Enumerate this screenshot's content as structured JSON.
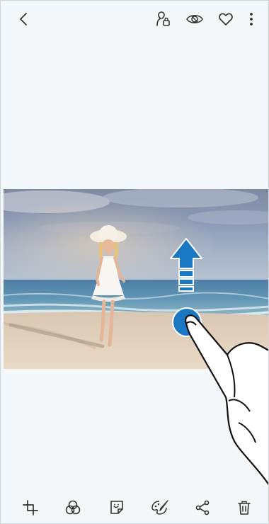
{
  "top_bar": {
    "back_icon": "chevron-left-icon",
    "portrait_icon": "portrait-effect-icon",
    "view_icon": "view-icon",
    "favorite_icon": "heart-icon",
    "more_icon": "more-vertical-icon"
  },
  "photo": {
    "subject": "girl-on-beach-photo"
  },
  "gesture": {
    "direction": "swipe-up",
    "arrow_color": "#1a77c2",
    "touch_color": "#1a77c2"
  },
  "bottom_bar": {
    "items": [
      {
        "icon": "crop-icon"
      },
      {
        "icon": "filter-icon"
      },
      {
        "icon": "sticker-icon"
      },
      {
        "icon": "paint-icon"
      },
      {
        "icon": "share-icon"
      },
      {
        "icon": "trash-icon"
      }
    ]
  },
  "colors": {
    "background": "#f4f7f9",
    "icon": "#333333",
    "accent": "#1a77c2"
  }
}
